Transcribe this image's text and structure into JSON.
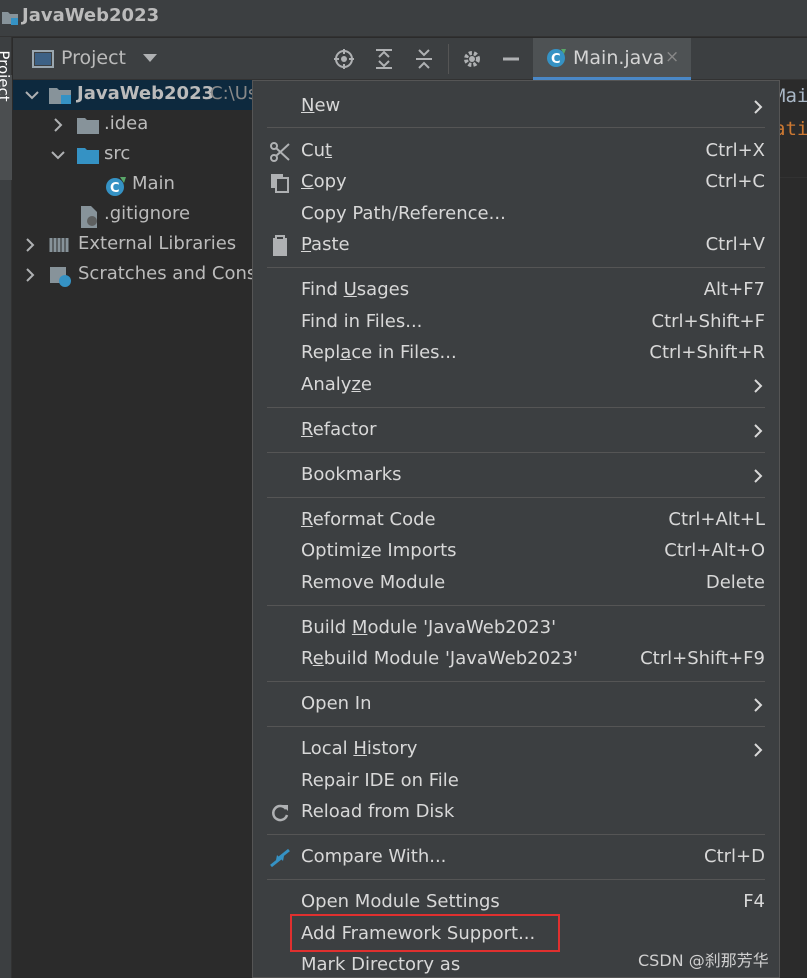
{
  "window": {
    "title": "JavaWeb2023",
    "side_tab": "Project"
  },
  "project_panel": {
    "title": "Project",
    "tree": [
      {
        "label": "JavaWeb2023",
        "path": "C:\\Us"
      },
      {
        "label": ".idea"
      },
      {
        "label": "src"
      },
      {
        "label": "Main"
      },
      {
        "label": ".gitignore"
      },
      {
        "label": "External Libraries"
      },
      {
        "label": "Scratches and Consoles"
      }
    ]
  },
  "editor": {
    "tab_label": "Main.java",
    "tab_close": "×",
    "line1": "Mai",
    "line2": "ati"
  },
  "context_menu": {
    "items": [
      {
        "label": "New",
        "mnemonic": "N",
        "submenu": true
      },
      {
        "label": "Cut",
        "mnemonic": "t",
        "shortcut": "Ctrl+X",
        "icon": "cut-icon"
      },
      {
        "label": "Copy",
        "mnemonic": "C",
        "shortcut": "Ctrl+C",
        "icon": "copy-icon"
      },
      {
        "label": "Copy Path/Reference..."
      },
      {
        "label": "Paste",
        "mnemonic": "P",
        "shortcut": "Ctrl+V",
        "icon": "paste-icon"
      },
      {
        "label": "Find Usages",
        "mnemonic": "U",
        "shortcut": "Alt+F7"
      },
      {
        "label": "Find in Files...",
        "shortcut": "Ctrl+Shift+F"
      },
      {
        "label": "Replace in Files...",
        "mnemonic": "a",
        "shortcut": "Ctrl+Shift+R"
      },
      {
        "label": "Analyze",
        "mnemonic": "z",
        "submenu": true
      },
      {
        "label": "Refactor",
        "mnemonic": "R",
        "submenu": true
      },
      {
        "label": "Bookmarks",
        "submenu": true
      },
      {
        "label": "Reformat Code",
        "mnemonic": "R",
        "shortcut": "Ctrl+Alt+L"
      },
      {
        "label": "Optimize Imports",
        "mnemonic": "z",
        "shortcut": "Ctrl+Alt+O"
      },
      {
        "label": "Remove Module",
        "shortcut": "Delete"
      },
      {
        "label": "Build Module 'JavaWeb2023'",
        "mnemonic": "M"
      },
      {
        "label": "Rebuild Module 'JavaWeb2023'",
        "mnemonic": "e",
        "shortcut": "Ctrl+Shift+F9"
      },
      {
        "label": "Open In",
        "submenu": true
      },
      {
        "label": "Local History",
        "mnemonic": "H",
        "submenu": true
      },
      {
        "label": "Repair IDE on File"
      },
      {
        "label": "Reload from Disk",
        "icon": "reload-icon"
      },
      {
        "label": "Compare With...",
        "shortcut": "Ctrl+D",
        "icon": "compare-icon"
      },
      {
        "label": "Open Module Settings",
        "shortcut": "F4"
      },
      {
        "label": "Add Framework Support..."
      },
      {
        "label": "Mark Directory as",
        "submenu": true
      }
    ]
  },
  "watermark": "CSDN @刹那芳华",
  "colors": {
    "accent": "#4a88c7",
    "highlight_box": "#e0302f",
    "selection": "#0d293e"
  }
}
